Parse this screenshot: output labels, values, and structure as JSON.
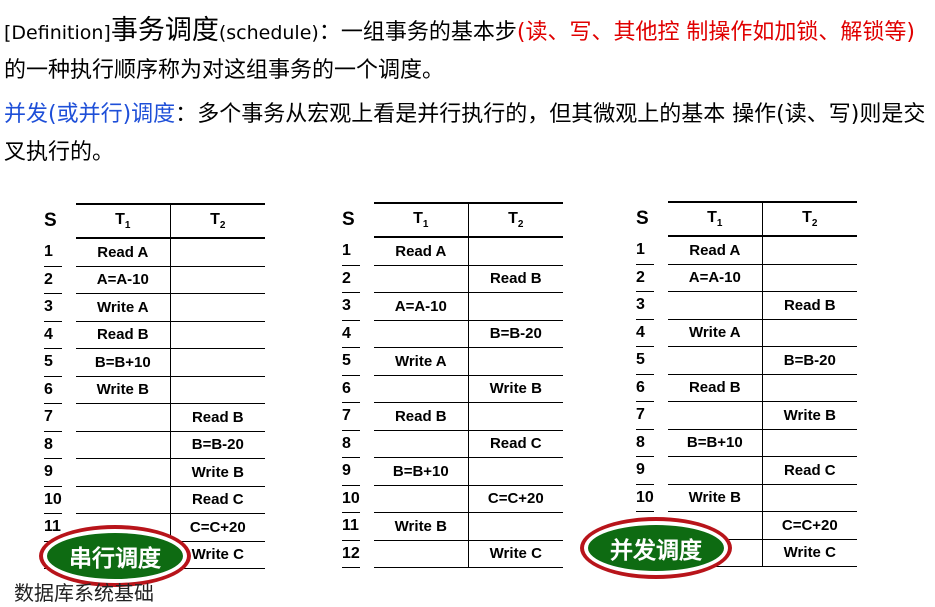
{
  "definition": {
    "tag": "[Definition]",
    "term": "事务调度",
    "term_en": "(schedule)",
    "colon": "：",
    "text_before": "一组事务的基本步",
    "red_text": "(读、写、其他控 制操作如加锁、解锁等)",
    "text_after": "的一种执行顺序称为对这组事务的一个调度。"
  },
  "concurrent_def": {
    "term": "并发(或并行)调度",
    "colon": "：",
    "text": "多个事务从宏观上看是并行执行的，但其微观上的基本 操作(读、写)则是交叉执行的。"
  },
  "headers": {
    "s": "S",
    "t1": "T",
    "t1_sub": "1",
    "t2": "T",
    "t2_sub": "2"
  },
  "schedule1": {
    "rows": [
      {
        "s": "1",
        "t1": "Read A",
        "t2": ""
      },
      {
        "s": "2",
        "t1": "A=A-10",
        "t2": ""
      },
      {
        "s": "3",
        "t1": "Write A",
        "t2": ""
      },
      {
        "s": "4",
        "t1": "Read B",
        "t2": ""
      },
      {
        "s": "5",
        "t1": "B=B+10",
        "t2": ""
      },
      {
        "s": "6",
        "t1": "Write B",
        "t2": ""
      },
      {
        "s": "7",
        "t1": "",
        "t2": "Read B"
      },
      {
        "s": "8",
        "t1": "",
        "t2": "B=B-20"
      },
      {
        "s": "9",
        "t1": "",
        "t2": "Write B"
      },
      {
        "s": "10",
        "t1": "",
        "t2": "Read C"
      },
      {
        "s": "11",
        "t1": "",
        "t2": "C=C+20"
      },
      {
        "s": "12",
        "t1": "",
        "t2": "Write C"
      }
    ],
    "badge": "串行调度"
  },
  "schedule2": {
    "rows": [
      {
        "s": "1",
        "t1": "Read A",
        "t2": ""
      },
      {
        "s": "2",
        "t1": "",
        "t2": "Read B"
      },
      {
        "s": "3",
        "t1": "A=A-10",
        "t2": ""
      },
      {
        "s": "4",
        "t1": "",
        "t2": "B=B-20"
      },
      {
        "s": "5",
        "t1": "Write A",
        "t2": ""
      },
      {
        "s": "6",
        "t1": "",
        "t2": "Write B"
      },
      {
        "s": "7",
        "t1": "Read B",
        "t2": ""
      },
      {
        "s": "8",
        "t1": "",
        "t2": "Read C"
      },
      {
        "s": "9",
        "t1": "B=B+10",
        "t2": ""
      },
      {
        "s": "10",
        "t1": "",
        "t2": "C=C+20"
      },
      {
        "s": "11",
        "t1": "Write B",
        "t2": ""
      },
      {
        "s": "12",
        "t1": "",
        "t2": "Write C"
      }
    ]
  },
  "schedule3": {
    "rows": [
      {
        "s": "1",
        "t1": "Read A",
        "t2": ""
      },
      {
        "s": "2",
        "t1": "A=A-10",
        "t2": ""
      },
      {
        "s": "3",
        "t1": "",
        "t2": "Read B"
      },
      {
        "s": "4",
        "t1": "Write A",
        "t2": ""
      },
      {
        "s": "5",
        "t1": "",
        "t2": "B=B-20"
      },
      {
        "s": "6",
        "t1": "Read B",
        "t2": ""
      },
      {
        "s": "7",
        "t1": "",
        "t2": "Write B"
      },
      {
        "s": "8",
        "t1": "B=B+10",
        "t2": ""
      },
      {
        "s": "9",
        "t1": "",
        "t2": "Read C"
      },
      {
        "s": "10",
        "t1": "Write B",
        "t2": ""
      },
      {
        "s": "11",
        "t1": "",
        "t2": "C=C+20"
      },
      {
        "s": "12",
        "t1": "",
        "t2": "Write C"
      }
    ],
    "badge": "并发调度"
  },
  "footer": "数据库系统基础",
  "colors": {
    "red": "#e00000",
    "blue": "#1e4fd8",
    "badge_green": "#0e6b12",
    "badge_ring": "#b8141a"
  }
}
